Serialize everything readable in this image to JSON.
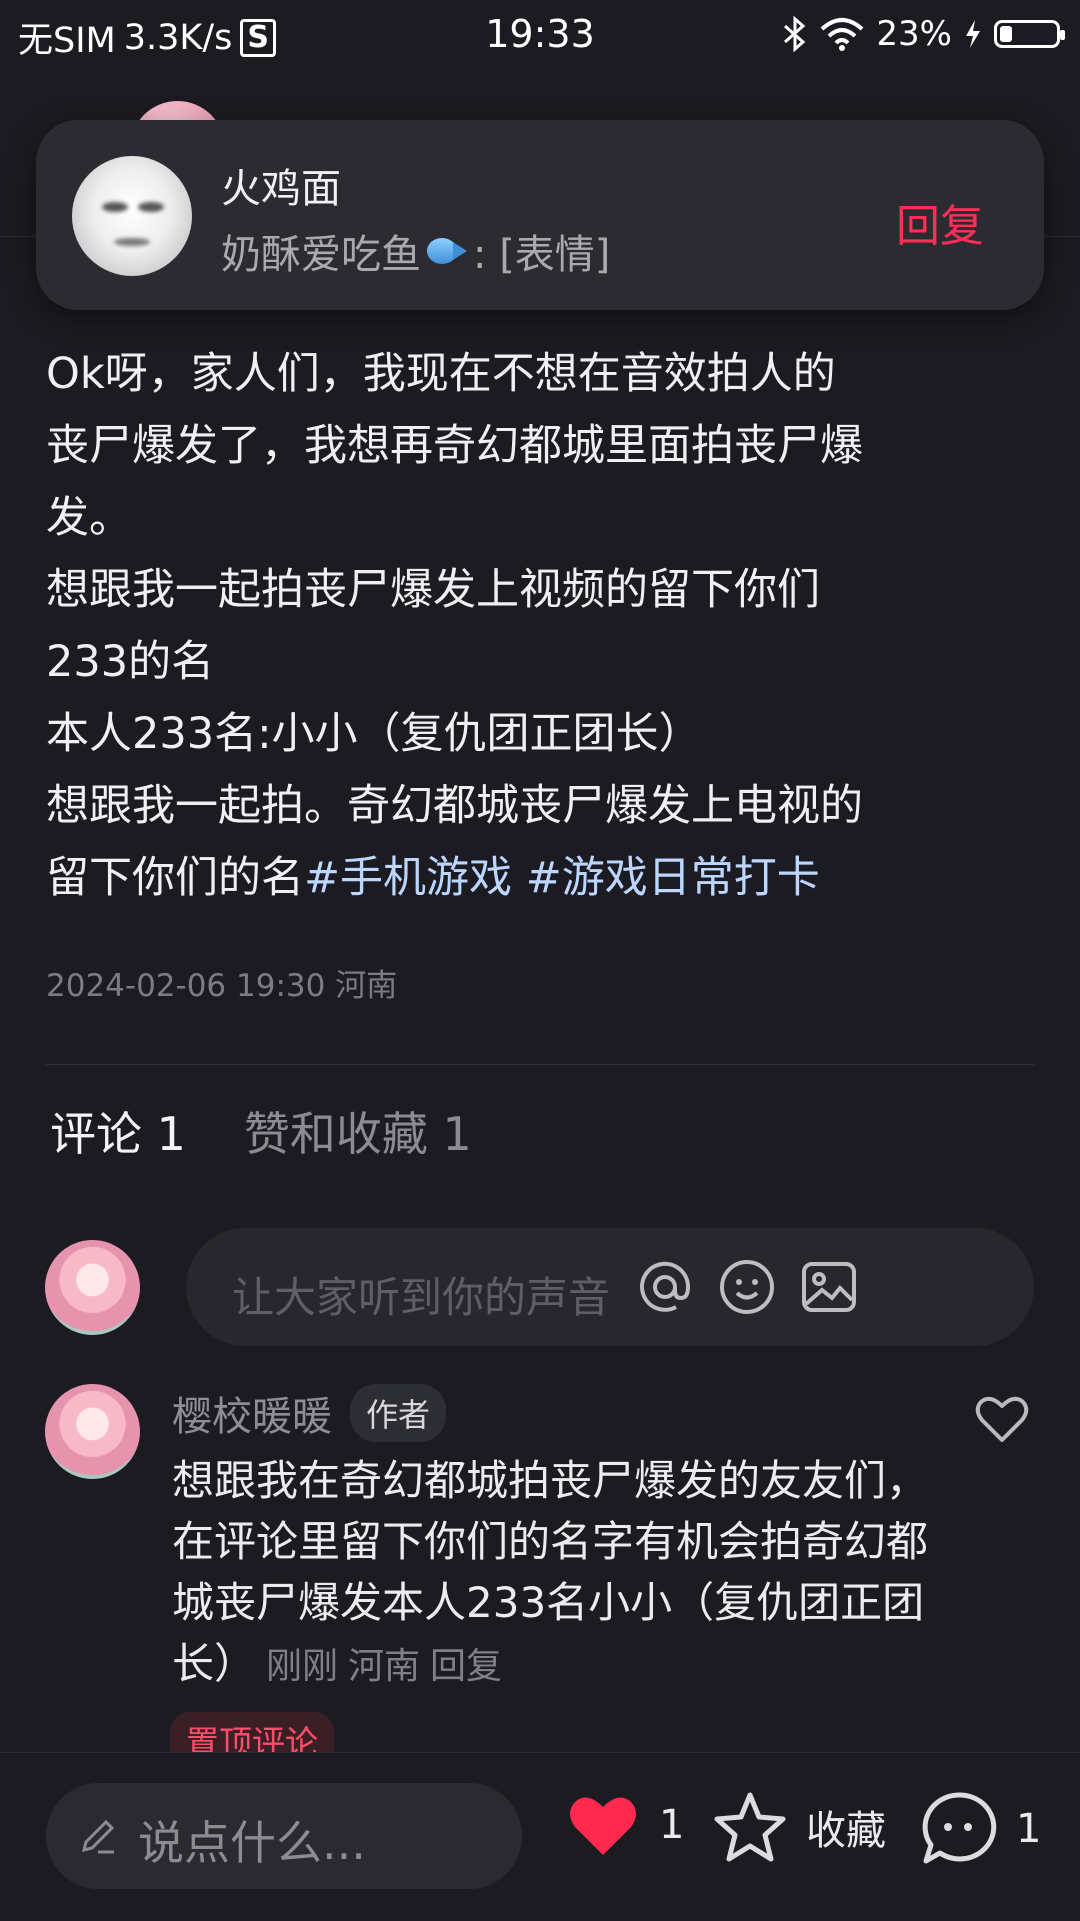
{
  "status_bar": {
    "carrier": "无SIM",
    "speed": "3.3K/s",
    "sim_icon": "S",
    "time": "19:33",
    "battery": "23%",
    "battery_level": 0.23
  },
  "notification": {
    "sender": "火鸡面",
    "message_prefix": "奶酥爱吃鱼",
    "message_suffix": ": [表情]",
    "reply_label": "回复"
  },
  "post": {
    "line1": "Ok呀，家人们，我现在不想在音效拍人的\n丧尸爆发了，我想再奇幻都城里面拍丧尸爆\n发。\n想跟我一起拍丧尸爆发上视频的留下你们\n233的名\n本人233名:小小（复仇团正团长）\n想跟我一起拍。奇幻都城丧尸爆发上电视的\n留下你们的名",
    "tag1": "#手机游戏",
    "tag2": "#游戏日常打卡",
    "meta": "2024-02-06 19:30 河南"
  },
  "tabs": {
    "comments": "评论 1",
    "likes": "赞和收藏 1"
  },
  "comment_input": {
    "placeholder": "让大家听到你的声音"
  },
  "comment": {
    "author": "樱校暖暖",
    "badge": "作者",
    "text": "想跟我在奇幻都城拍丧尸爆发的友友们，在评论里留下你们的名字有机会拍奇幻都城丧尸爆发本人233名小小（复仇团正团长）",
    "time": "刚刚",
    "location": "河南",
    "reply": "回复",
    "pinned": "置顶评论"
  },
  "bottom_bar": {
    "input_placeholder": "说点什么...",
    "like_count": "1",
    "collect_label": "收藏",
    "comment_count": "1",
    "like_color": "#ff2a4d"
  }
}
